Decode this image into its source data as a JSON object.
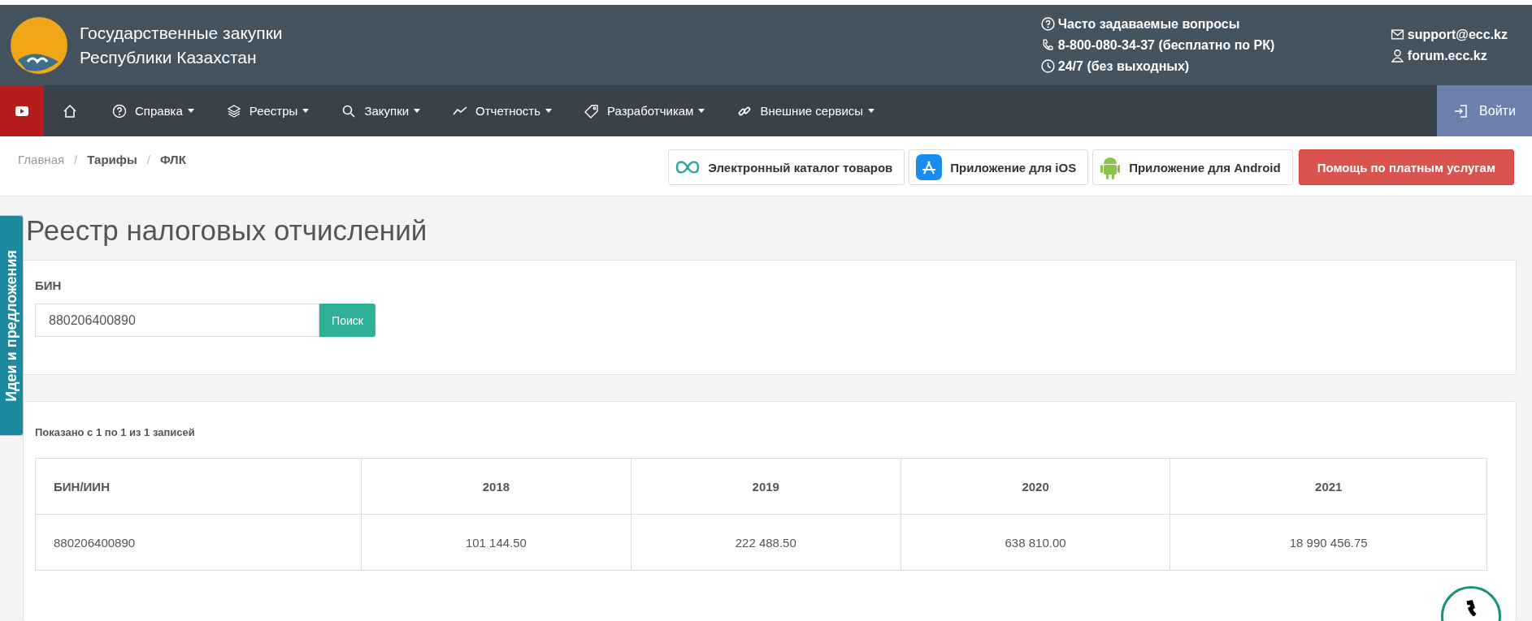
{
  "header": {
    "title_lines": [
      "Государственные закупки",
      "Республики Казахстан"
    ],
    "contacts": [
      {
        "kind": "faq",
        "text": "Часто задаваемые вопросы"
      },
      {
        "kind": "phone",
        "text": "8-800-080-34-37 (бесплатно по РК)"
      },
      {
        "kind": "clock",
        "text": "24/7 (без выходных)"
      }
    ],
    "links": [
      {
        "kind": "mail",
        "text": "support@ecc.kz"
      },
      {
        "kind": "user",
        "text": "forum.ecc.kz"
      }
    ]
  },
  "nav": {
    "items": [
      {
        "kind": "help",
        "label": "Справка"
      },
      {
        "kind": "layers",
        "label": "Реестры"
      },
      {
        "kind": "search",
        "label": "Закупки"
      },
      {
        "kind": "chart",
        "label": "Отчетность"
      },
      {
        "kind": "tag",
        "label": "Разработчикам"
      },
      {
        "kind": "link",
        "label": "Внешние сервисы"
      }
    ],
    "login": "Войти"
  },
  "breadcrumb": [
    "Главная",
    "Тарифы",
    "ФЛК"
  ],
  "breadcrumb_separators": [
    "/",
    "/"
  ],
  "actions": [
    {
      "kind": "catalog",
      "label": "Электронный каталог товаров"
    },
    {
      "kind": "ios",
      "label": "Приложение для iOS"
    },
    {
      "kind": "android",
      "label": "Приложение для Android"
    },
    {
      "kind": "danger",
      "label": "Помощь по платным услугам"
    }
  ],
  "side_tab": "Идеи и предложения",
  "page_title": "Реестр налоговых отчислений",
  "form": {
    "label": "БИН",
    "value": "880206400890",
    "button": "Поиск"
  },
  "table": {
    "info": "Показано с 1 по 1 из 1 записей",
    "columns": [
      "БИН/ИИН",
      "2018",
      "2019",
      "2020",
      "2021"
    ],
    "rows": [
      [
        "880206400890",
        "101 144.50",
        "222 488.50",
        "638 810.00",
        "18 990 456.75"
      ]
    ]
  }
}
